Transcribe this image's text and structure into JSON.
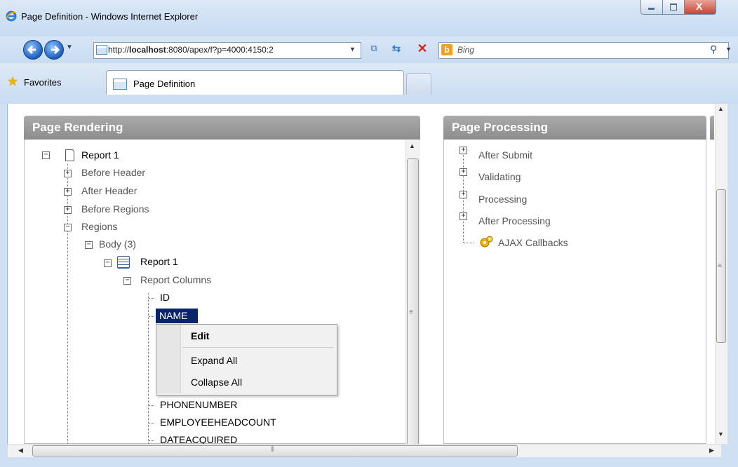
{
  "window": {
    "title": "Page Definition - Windows Internet Explorer",
    "controls": {
      "minimize": "–",
      "maximize": "□",
      "close": "X"
    }
  },
  "address_bar": {
    "url": "http://localhost:8080/apex/f?p=4000:4150:2",
    "url_host": "localhost",
    "search_placeholder": "Bing",
    "search_engine": "b"
  },
  "favorites_bar": {
    "favorites_label": "Favorites",
    "tab_label": "Page Definition"
  },
  "page_rendering": {
    "heading": "Page Rendering",
    "tree": {
      "root": "Report 1",
      "before_header": "Before Header",
      "after_header": "After Header",
      "before_regions": "Before Regions",
      "regions": "Regions",
      "body": "Body (3)",
      "report": "Report 1",
      "report_columns": "Report Columns",
      "columns": [
        "ID",
        "NAME",
        "PHONENUMBER",
        "EMPLOYEEHEADCOUNT",
        "DATEACQUIRED"
      ]
    }
  },
  "context_menu": {
    "items": [
      "Edit",
      "Expand All",
      "Collapse All"
    ]
  },
  "page_processing": {
    "heading": "Page Processing",
    "items": [
      "After Submit",
      "Validating",
      "Processing",
      "After Processing",
      "AJAX Callbacks"
    ]
  },
  "colors": {
    "panel_header": "#999999",
    "selection": "#0a246a",
    "window_frame": "#cfe0f3"
  },
  "icons": {
    "ie_logo": "ie-logo-icon",
    "favorites_star": "star-icon",
    "gear": "gear-icon"
  }
}
